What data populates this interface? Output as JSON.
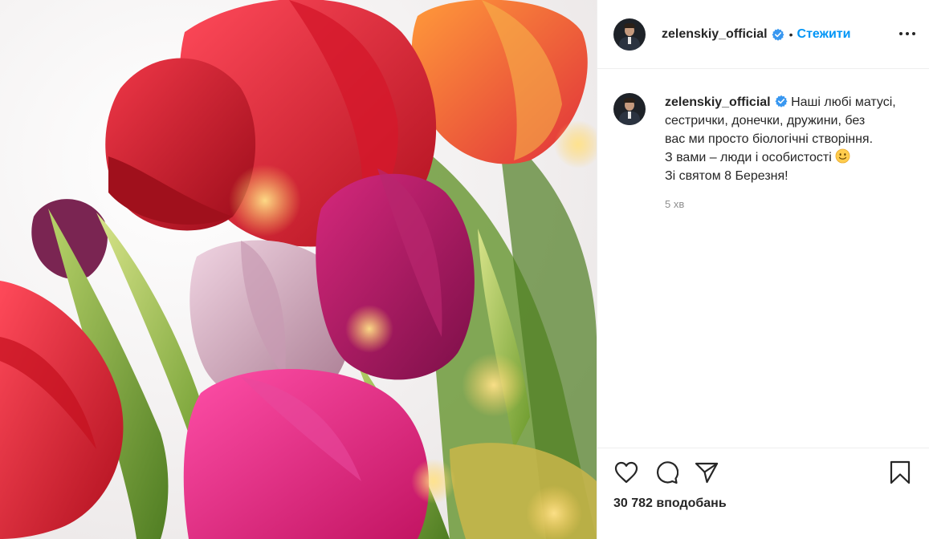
{
  "post": {
    "username": "zelenskiy_official",
    "follow_label": "Стежити",
    "separator": "•"
  },
  "caption": {
    "username": "zelenskiy_official",
    "line1": "Наші любі матусі,",
    "line2": "сестрички, донечки, дружини, без",
    "line3": "вас ми просто біологічні створіння.",
    "line4": "З вами – люди і особистості",
    "line5": "Зі святом 8 Березня!",
    "time": "5 хв"
  },
  "likes": {
    "text": "30 782 вподобань"
  },
  "icons": {
    "verified": "verified-badge-icon",
    "more": "more-options-icon",
    "like": "heart-icon",
    "comment": "comment-icon",
    "share": "paper-plane-icon",
    "save": "bookmark-icon",
    "emoji": "slightly-smiling-face-icon"
  },
  "colors": {
    "accent": "#0095f6",
    "text": "#262626",
    "muted": "#8e8e8e",
    "border": "#efefef"
  },
  "image": {
    "subject": "bouquet of red, pink and purple tulips"
  }
}
